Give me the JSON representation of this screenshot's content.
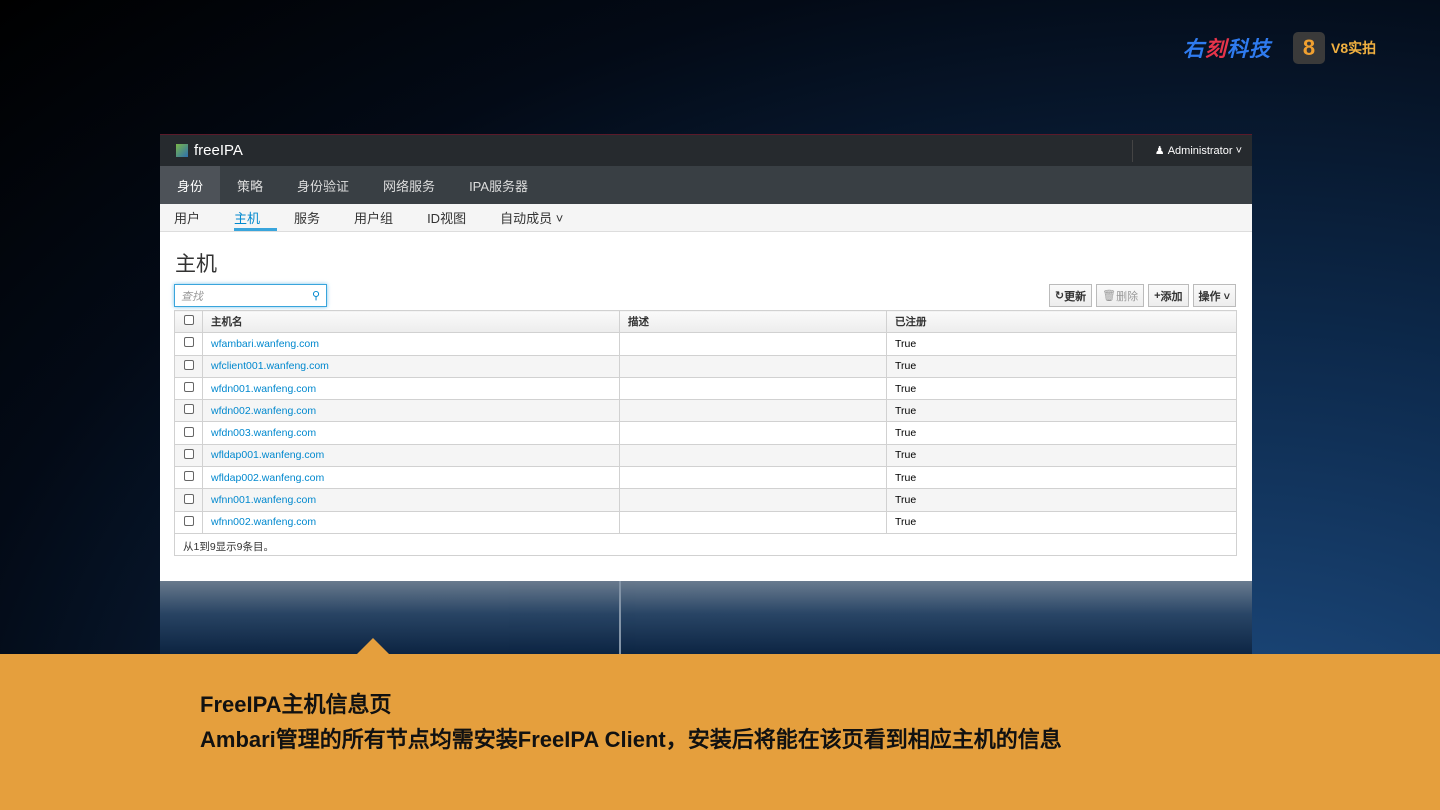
{
  "brand": {
    "logo": "右刻科技",
    "logo_red": "刻",
    "v8_label": "V8实拍"
  },
  "app": {
    "name": "freeIPA",
    "user": "Administrator ˅",
    "nav_primary": [
      "身份",
      "策略",
      "身份验证",
      "网络服务",
      "IPA服务器"
    ],
    "nav_secondary": [
      "用户",
      "主机",
      "服务",
      "用户组",
      "ID视图",
      "自动成员 ˅"
    ],
    "page_title": "主机",
    "search_placeholder": "查找",
    "buttons": {
      "refresh": "更新",
      "delete": "删除",
      "add": "添加",
      "actions": "操作 ˅"
    },
    "columns": [
      "主机名",
      "描述",
      "已注册"
    ],
    "rows": [
      {
        "host": "wfambari.wanfeng.com",
        "desc": "",
        "registered": "True"
      },
      {
        "host": "wfclient001.wanfeng.com",
        "desc": "",
        "registered": "True"
      },
      {
        "host": "wfdn001.wanfeng.com",
        "desc": "",
        "registered": "True"
      },
      {
        "host": "wfdn002.wanfeng.com",
        "desc": "",
        "registered": "True"
      },
      {
        "host": "wfdn003.wanfeng.com",
        "desc": "",
        "registered": "True"
      },
      {
        "host": "wfldap001.wanfeng.com",
        "desc": "",
        "registered": "True"
      },
      {
        "host": "wfldap002.wanfeng.com",
        "desc": "",
        "registered": "True"
      },
      {
        "host": "wfnn001.wanfeng.com",
        "desc": "",
        "registered": "True"
      },
      {
        "host": "wfnn002.wanfeng.com",
        "desc": "",
        "registered": "True"
      }
    ],
    "footer": "从1到9显示9条目。"
  },
  "caption": {
    "line1": "FreeIPA主机信息页",
    "line2": "Ambari管理的所有节点均需安装FreeIPA Client，安装后将能在该页看到相应主机的信息"
  }
}
